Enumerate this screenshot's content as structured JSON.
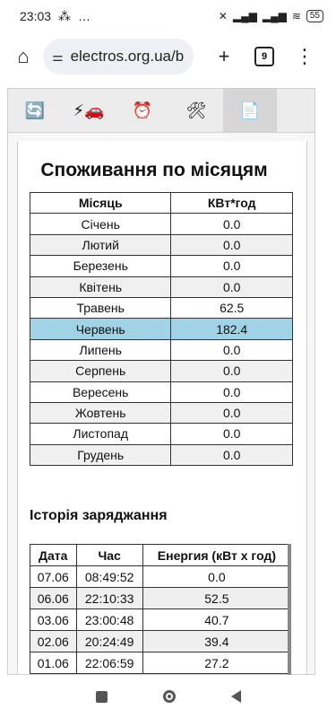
{
  "status_bar": {
    "time": "23:03",
    "left_icons": [
      "⁂",
      "…"
    ],
    "battery": "55"
  },
  "browser": {
    "url": "electros.org.ua/b",
    "tabs_count": "9"
  },
  "nav_tabs": [
    {
      "icon": "🔄",
      "name": "refresh"
    },
    {
      "icon": "⚡🚗",
      "name": "charging"
    },
    {
      "icon": "⏰",
      "name": "schedule"
    },
    {
      "icon": "🛠",
      "name": "settings"
    },
    {
      "icon": "📄",
      "name": "report"
    }
  ],
  "monthly": {
    "title": "Споживання по місяцям",
    "headers": [
      "Місяць",
      "КВт*год"
    ],
    "rows": [
      {
        "month": "Січень",
        "value": "0.0"
      },
      {
        "month": "Лютий",
        "value": "0.0"
      },
      {
        "month": "Березень",
        "value": "0.0"
      },
      {
        "month": "Квітень",
        "value": "0.0"
      },
      {
        "month": "Травень",
        "value": "62.5"
      },
      {
        "month": "Червень",
        "value": "182.4"
      },
      {
        "month": "Липень",
        "value": "0.0"
      },
      {
        "month": "Серпень",
        "value": "0.0"
      },
      {
        "month": "Вересень",
        "value": "0.0"
      },
      {
        "month": "Жовтень",
        "value": "0.0"
      },
      {
        "month": "Листопад",
        "value": "0.0"
      },
      {
        "month": "Грудень",
        "value": "0.0"
      }
    ]
  },
  "history": {
    "title": "Історія заряджання",
    "headers": [
      "Дата",
      "Час",
      "Енергия (кВт х год)"
    ],
    "rows": [
      {
        "date": "07.06",
        "time": "08:49:52",
        "energy": "0.0"
      },
      {
        "date": "06.06",
        "time": "22:10:33",
        "energy": "52.5"
      },
      {
        "date": "03.06",
        "time": "23:00:48",
        "energy": "40.7"
      },
      {
        "date": "02.06",
        "time": "20:24:49",
        "energy": "39.4"
      },
      {
        "date": "01.06",
        "time": "22:06:59",
        "energy": "27.2"
      }
    ]
  },
  "colors": {
    "highlight_row": "#9fd3e5"
  }
}
